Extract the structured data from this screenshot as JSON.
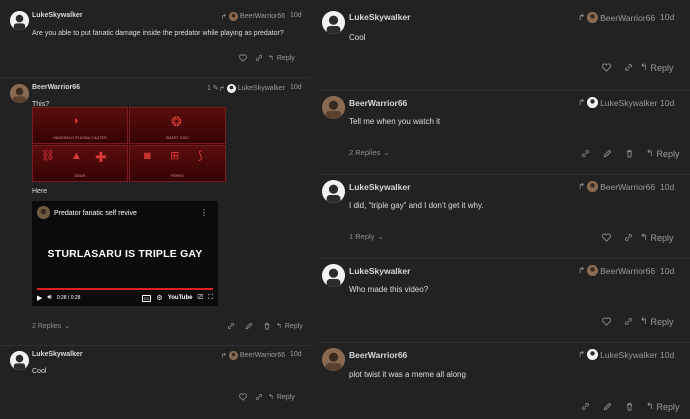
{
  "accent": "#e23a3a",
  "posts": {
    "left": [
      {
        "username": "LukeSkywalker",
        "reply_to": "BeerWarrior66",
        "date": "10d",
        "body": "Are you able to put fanatic damage inside the predator while playing as predator?",
        "reply_label": "Reply"
      },
      {
        "username": "BeerWarrior66",
        "edit_count": "1",
        "reply_to": "LukeSkywalker",
        "date": "10d",
        "body_1": "This?",
        "body_2": "Here",
        "replies": "2 Replies",
        "reply_label": "Reply"
      },
      {
        "username": "LukeSkywalker",
        "reply_to": "BeerWarrior66",
        "date": "10d",
        "body": "Cool",
        "reply_label": "Reply"
      }
    ],
    "right": [
      {
        "username": "LukeSkywalker",
        "reply_to": "BeerWarrior66",
        "date": "10d",
        "body": "Cool",
        "reply_label": "Reply"
      },
      {
        "username": "BeerWarrior66",
        "reply_to": "LukeSkywalker",
        "date": "10d",
        "body": "Tell me when you watch it",
        "replies": "2 Replies",
        "reply_label": "Reply"
      },
      {
        "username": "LukeSkywalker",
        "reply_to": "BeerWarrior66",
        "date": "10d",
        "body": "I did, “triple gay” and I don’t get it why.",
        "replies": "1 Reply",
        "reply_label": "Reply"
      },
      {
        "username": "LukeSkywalker",
        "reply_to": "BeerWarrior66",
        "date": "10d",
        "body": "Who made this video?",
        "reply_label": "Reply"
      },
      {
        "username": "BeerWarrior66",
        "reply_to": "LukeSkywalker",
        "date": "10d",
        "body": "plot twist it was a meme all along",
        "reply_label": "Reply"
      }
    ]
  },
  "game_image": {
    "captions": [
      "HANDHELD PLASMA CASTER",
      "SMART DISC",
      "GEAR",
      "PERKS"
    ]
  },
  "video": {
    "title": "Predator fanatic self revive",
    "overlay_text": "STURLASARU IS TRIPLE GAY",
    "time": "0:28 / 0:28",
    "brand": "YouTube",
    "progress": 1.0
  },
  "icons": {
    "like": "heart-icon",
    "link": "link-icon",
    "edit": "pencil-icon",
    "delete": "trash-icon",
    "reply": "reply-icon",
    "reply_to": "reply-arrow-icon",
    "expand": "chevron-down-icon"
  }
}
